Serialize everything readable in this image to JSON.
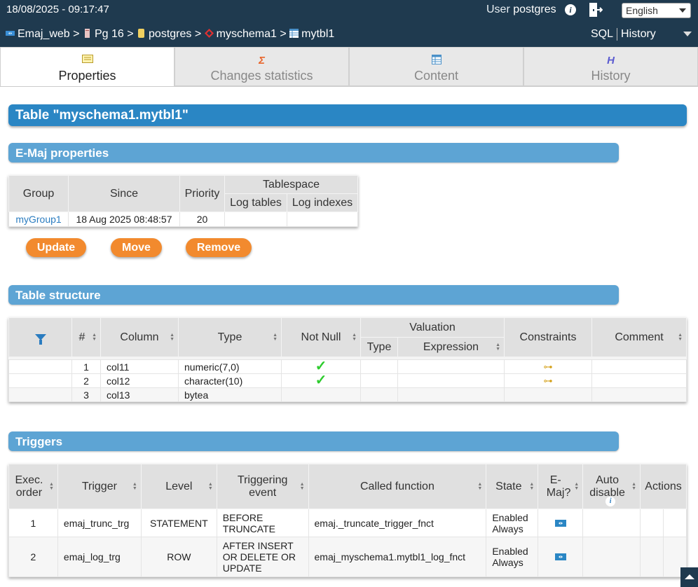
{
  "header": {
    "datetime": "18/08/2025 - 09:17:47",
    "user_label": "User",
    "user_name": "postgres",
    "language": "English"
  },
  "breadcrumb": [
    {
      "label": "Emaj_web",
      "sep": ">"
    },
    {
      "label": "Pg 16",
      "sep": ">"
    },
    {
      "label": "postgres",
      "sep": ">"
    },
    {
      "label": "myschema1",
      "sep": ">"
    },
    {
      "label": "mytbl1",
      "sep": ""
    }
  ],
  "topnav": {
    "sql": "SQL",
    "history": "History"
  },
  "tabs": [
    {
      "label": "Properties",
      "icon": "properties-icon"
    },
    {
      "label": "Changes statistics",
      "icon": "sigma-icon"
    },
    {
      "label": "Content",
      "icon": "table-icon"
    },
    {
      "label": "History",
      "icon": "history-icon"
    }
  ],
  "page_title": "Table \"myschema1.mytbl1\"",
  "emaj_section": {
    "title": "E-Maj properties",
    "headers": {
      "group": "Group",
      "since": "Since",
      "priority": "Priority",
      "tablespace": "Tablespace",
      "log_tables": "Log tables",
      "log_indexes": "Log indexes"
    },
    "row": {
      "group": "myGroup1",
      "since": "18 Aug 2025 08:48:57",
      "priority": "20",
      "log_tables": "",
      "log_indexes": ""
    },
    "buttons": {
      "update": "Update",
      "move": "Move",
      "remove": "Remove"
    }
  },
  "structure_section": {
    "title": "Table structure",
    "headers": {
      "num": "#",
      "column": "Column",
      "type": "Type",
      "not_null": "Not Null",
      "valuation": "Valuation",
      "val_type": "Type",
      "val_expr": "Expression",
      "constraints": "Constraints",
      "comment": "Comment"
    },
    "rows": [
      {
        "num": "1",
        "column": "col11",
        "type": "numeric(7,0)",
        "not_null": true,
        "constraint": "primary-key-icon"
      },
      {
        "num": "2",
        "column": "col12",
        "type": "character(10)",
        "not_null": true,
        "constraint": "primary-key-icon"
      },
      {
        "num": "3",
        "column": "col13",
        "type": "bytea",
        "not_null": false,
        "constraint": ""
      }
    ]
  },
  "triggers_section": {
    "title": "Triggers",
    "headers": {
      "exec_order": "Exec. order",
      "trigger": "Trigger",
      "level": "Level",
      "event": "Triggering event",
      "function": "Called function",
      "state": "State",
      "emaj": "E-Maj?",
      "auto_disable": "Auto disable",
      "actions": "Actions"
    },
    "rows": [
      {
        "order": "1",
        "trigger": "emaj_trunc_trg",
        "level": "STATEMENT",
        "event": "BEFORE TRUNCATE",
        "function": "emaj._truncate_trigger_fnct",
        "state": "Enabled Always"
      },
      {
        "order": "2",
        "trigger": "emaj_log_trg",
        "level": "ROW",
        "event": "AFTER INSERT OR DELETE OR UPDATE",
        "function": "emaj_myschema1.mytbl1_log_fnct",
        "state": "Enabled Always"
      }
    ]
  },
  "colors": {
    "topbar": "#1f3a4f",
    "title_bar": "#2a86c4",
    "section_bar": "#5da4d4",
    "button": "#f28a2e",
    "check": "#2ecc2e"
  }
}
